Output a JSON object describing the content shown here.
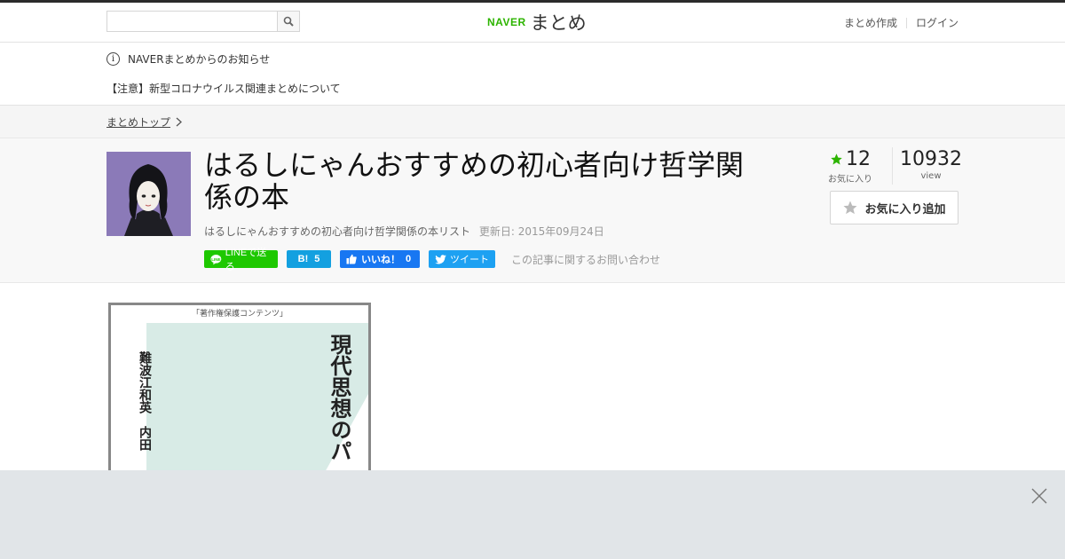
{
  "header": {
    "search_placeholder": "",
    "logo_brand": "NAVER",
    "logo_service": "まとめ",
    "links": [
      "まとめ作成",
      "ログイン"
    ]
  },
  "notice": {
    "title": "NAVERまとめからのお知らせ",
    "item": "【注意】新型コロナウイルス関連まとめについて"
  },
  "breadcrumb": {
    "top": "まとめトップ"
  },
  "article": {
    "title": "はるしにゃんおすすめの初心者向け哲学関係の本",
    "description": "はるしにゃんおすすめの初心者向け哲学関係の本リスト",
    "updated": "更新日: 2015年09月24日",
    "favorites": "12",
    "favorites_label": "お気に入り",
    "views": "10932",
    "views_label": "view",
    "fav_button": "お気に入り追加"
  },
  "share": {
    "line": "LINEで送る",
    "hatena_label": "B!",
    "hatena_count": "5",
    "facebook": "いいね！",
    "facebook_count": "0",
    "twitter": "ツイート",
    "inquiry": "この記事に関するお問い合わせ"
  },
  "book": {
    "header": "「著作権保護コンテンツ」",
    "authors": "難波江和英　内田",
    "title": "現代思想のパ"
  },
  "colors": {
    "accent_green": "#2db400",
    "line_green": "#1ec800",
    "hatena_blue": "#13a0e0",
    "facebook_blue": "#1877f2",
    "twitter_blue": "#1da1f2"
  },
  "icons": [
    "search-icon",
    "info-icon",
    "chevron-right-icon",
    "star-icon",
    "close-icon"
  ]
}
